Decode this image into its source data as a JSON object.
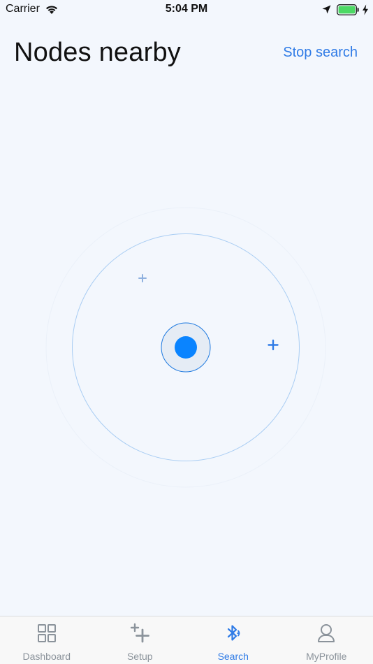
{
  "status_bar": {
    "carrier": "Carrier",
    "time": "5:04 PM",
    "icons": [
      "wifi-icon",
      "location-arrow-icon",
      "battery-icon",
      "charging-bolt-icon"
    ]
  },
  "header": {
    "title": "Nodes nearby",
    "action_label": "Stop search"
  },
  "radar": {
    "center_icon": "user-location-dot",
    "nodes": [
      {
        "icon": "plus-icon",
        "state": "faded"
      },
      {
        "icon": "plus-icon",
        "state": "active"
      }
    ]
  },
  "tab_bar": {
    "active_index": 2,
    "tabs": [
      {
        "label": "Dashboard",
        "icon": "grid-icon"
      },
      {
        "label": "Setup",
        "icon": "add-plus-icon"
      },
      {
        "label": "Search",
        "icon": "bluetooth-search-icon"
      },
      {
        "label": "MyProfile",
        "icon": "user-profile-icon"
      }
    ]
  },
  "colors": {
    "background": "#f3f7fd",
    "accent": "#2f7be6",
    "radar_ring": "#a9cdf3",
    "center_dot": "#0a84ff",
    "tab_inactive": "#8b939b",
    "battery_fill": "#4cd964"
  }
}
